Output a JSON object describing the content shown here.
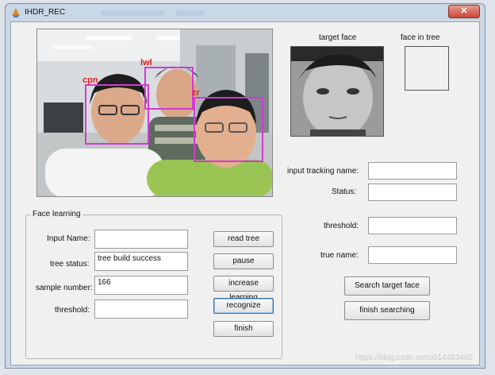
{
  "window": {
    "title": "IHDR_REC",
    "close_glyph": "✕"
  },
  "camera": {
    "labels": [
      "cpn",
      "lwl",
      "zr"
    ],
    "box_color": "#d23ad2"
  },
  "right_panel": {
    "target_face_label": "target face",
    "face_in_tree_label": "face in tree",
    "input_tracking_label": "input tracking name:",
    "input_tracking_value": "",
    "status_label": "Status:",
    "status_value": "",
    "threshold_label": "threshold:",
    "threshold_value": "",
    "true_name_label": "true name:",
    "true_name_value": "",
    "search_button": "Search target face",
    "finish_searching_button": "finish searching"
  },
  "face_learning": {
    "group_title": "Face learning",
    "input_name_label": "Input Name:",
    "input_name_value": "",
    "tree_status_label": "tree status:",
    "tree_status_value": "tree build success",
    "sample_number_label": "sample number:",
    "sample_number_value": "166",
    "threshold_label": "threshold:",
    "threshold_value": "",
    "buttons": {
      "read_tree": "read tree",
      "pause": "pause",
      "increase_learning": "increase learning",
      "recognize": "recognize",
      "finish": "finish"
    }
  },
  "watermark": "https://blog.csdn.net/u014483460"
}
